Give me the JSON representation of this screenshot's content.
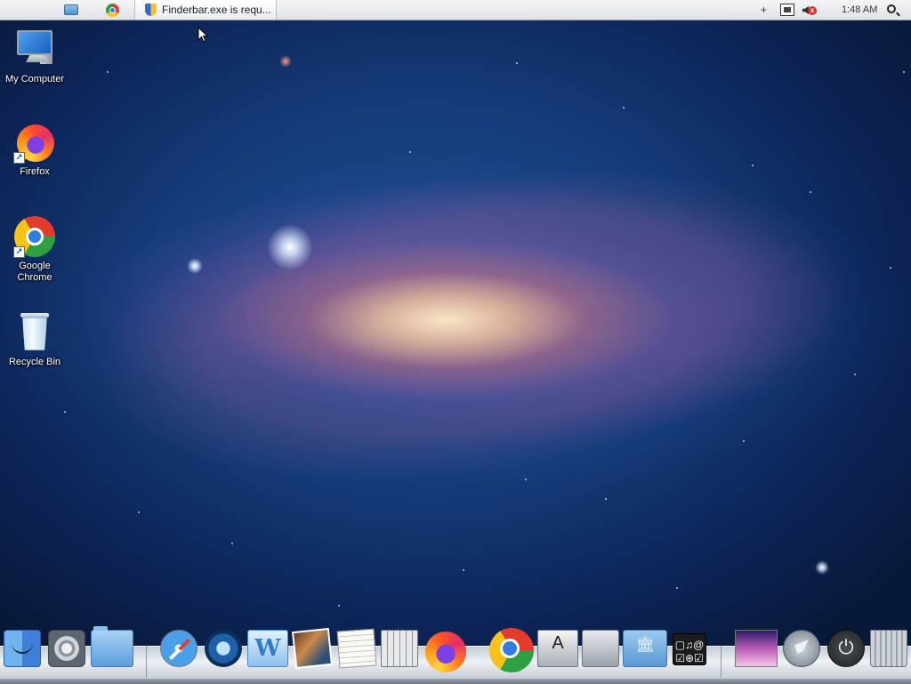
{
  "menubar": {
    "apple_icon": "apple-icon",
    "apps": [
      {
        "icon": "folder-icon"
      },
      {
        "icon": "chrome-icon"
      }
    ],
    "task": {
      "label": "Finderbar.exe is requ...",
      "icon": "shield-icon"
    },
    "tray": {
      "plus_glyph": "+",
      "clock": "1:48 AM",
      "icons": [
        "network-icon",
        "volume-muted-icon",
        "spotlight-search-icon"
      ]
    }
  },
  "desktop": {
    "icons": [
      {
        "label": "My Computer",
        "icon": "computer-icon"
      },
      {
        "label": "Firefox",
        "icon": "firefox-icon"
      },
      {
        "label": "Google Chrome",
        "icon": "chrome-icon"
      },
      {
        "label": "Recycle Bin",
        "icon": "recycle-bin-icon"
      }
    ]
  },
  "dock": {
    "items": [
      {
        "icon": "finder-icon"
      },
      {
        "icon": "system-preferences-icon"
      },
      {
        "icon": "applications-folder-icon"
      },
      {
        "icon": "safari-icon"
      },
      {
        "icon": "quicktime-icon"
      },
      {
        "icon": "word-icon"
      },
      {
        "icon": "photo-viewer-icon"
      },
      {
        "icon": "textedit-icon"
      },
      {
        "icon": "calculator-icon"
      },
      {
        "icon": "firefox-icon"
      },
      {
        "icon": "chrome-icon"
      },
      {
        "icon": "app-store-icon"
      },
      {
        "icon": "disk-utility-icon"
      },
      {
        "icon": "library-folder-icon"
      },
      {
        "icon": "widgets-icon"
      },
      {
        "icon": "image-icon"
      },
      {
        "icon": "launchpad-icon"
      },
      {
        "icon": "power-icon"
      },
      {
        "icon": "trash-icon"
      }
    ],
    "widgets_glyphs": "▢♫@\n☑⊕☑"
  }
}
